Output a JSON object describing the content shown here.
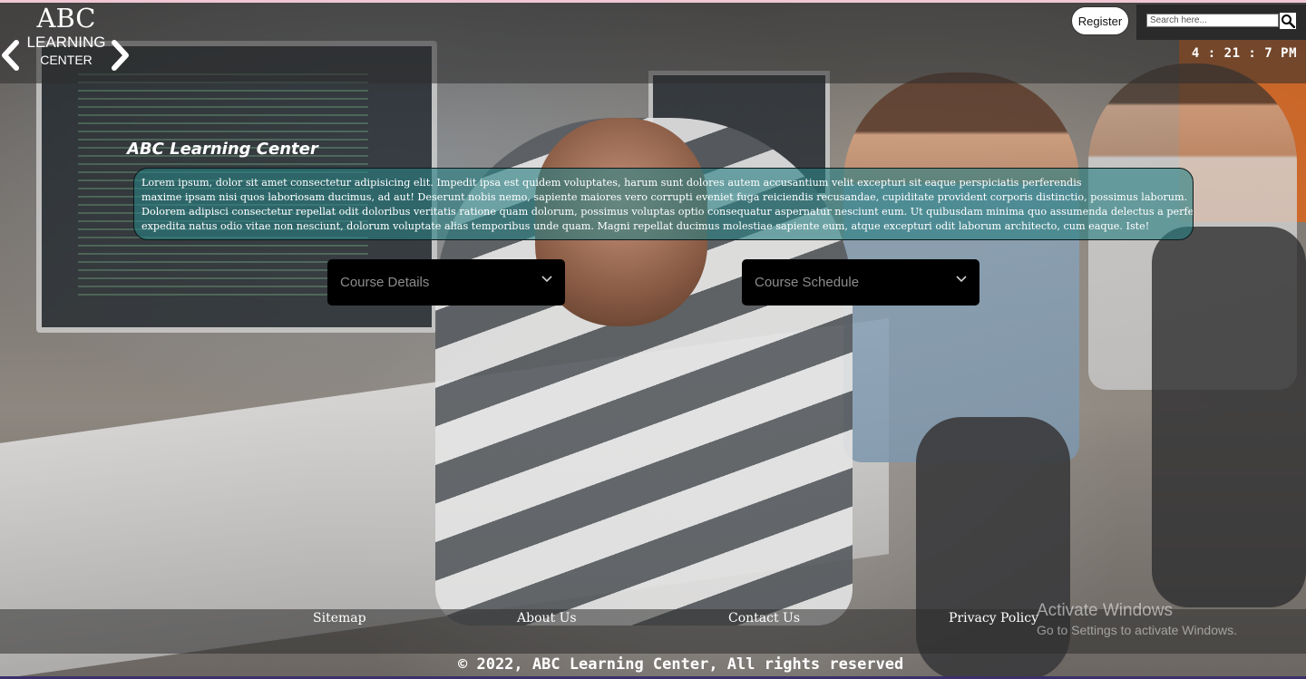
{
  "logo": {
    "line1": "ABC",
    "line2": "LEARNING",
    "line3": "CENTER"
  },
  "header": {
    "register_label": "Register",
    "search_placeholder": "Search here...",
    "clock": "4 : 21 : 7 PM"
  },
  "hero": {
    "title": "ABC Learning Center",
    "paragraph_lines": [
      "Lorem ipsum, dolor sit amet consectetur adipisicing elit. Impedit ipsa est quidem voluptates, harum sunt dolores autem accusantium velit excepturi sit eaque perspiciatis perferendis",
      "maxime ipsam nisi quos laboriosam ducimus, ad aut! Deserunt nobis nemo, sapiente maiores vero corrupti eveniet fuga reiciendis recusandae, cupiditate provident corporis distinctio, possimus laborum.",
      "Dolorem adipisci consectetur repellat odit doloribus veritatis ratione quam dolorum, possimus voluptas optio consequatur aspernatur nesciunt eum. Ut quibusdam minima quo assumenda delectus a perferendis",
      "expedita natus odio vitae non nesciunt, dolorum voluptate alias temporibus unde quam. Magni repellat ducimus molestiae sapiente eum, atque excepturi odit laborum architecto, cum eaque. Iste!"
    ]
  },
  "dropdowns": {
    "course_details": "Course Details",
    "course_schedule": "Course Schedule"
  },
  "footer": {
    "links": [
      "Sitemap",
      "About Us",
      "Contact Us",
      "Privacy Policy"
    ],
    "copyright": "© 2022, ABC Learning Center, All rights reserved"
  },
  "overlay": {
    "activate_title": "Activate Windows",
    "activate_sub": "Go to Settings to activate Windows."
  },
  "colors": {
    "text_box_bg": "#28807f",
    "dropdown_bg": "#000000",
    "header_bg": "#2d2d2d"
  }
}
